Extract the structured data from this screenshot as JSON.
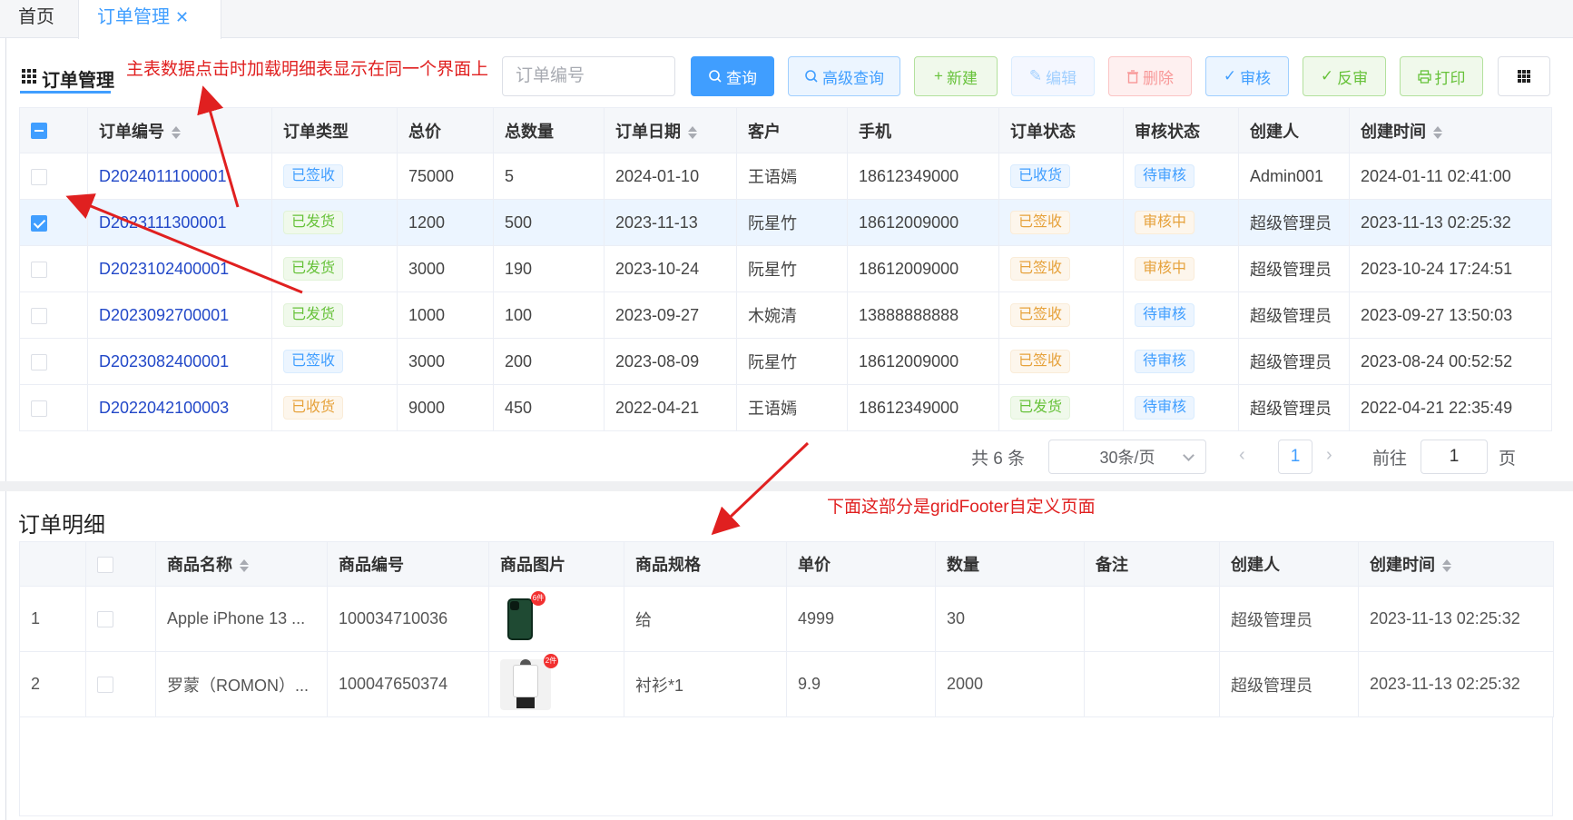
{
  "tabs": {
    "home": "首页",
    "active": "订单管理",
    "close": "✕"
  },
  "page_title": "订单管理",
  "annotations": {
    "top": "主表数据点击时加载明细表显示在同一个界面上",
    "bottom": "下面这部分是gridFooter自定义页面"
  },
  "search": {
    "placeholder": "订单编号"
  },
  "toolbar": {
    "query": "查询",
    "advanced": "高级查询",
    "new": "新建",
    "edit": "编辑",
    "delete": "删除",
    "audit": "审核",
    "unaudit": "反审",
    "print": "打印"
  },
  "main_table": {
    "headers": [
      "订单编号",
      "订单类型",
      "总价",
      "总数量",
      "订单日期",
      "客户",
      "手机",
      "订单状态",
      "审核状态",
      "创建人",
      "创建时间"
    ],
    "rows": [
      {
        "checked": false,
        "order_no": "D2024011100001",
        "type": "已签收",
        "type_color": "blue",
        "total": "75000",
        "qty": "5",
        "date": "2024-01-10",
        "customer": "王语嫣",
        "phone": "18612349000",
        "status": "已收货",
        "status_color": "blue",
        "audit": "待审核",
        "audit_color": "blue",
        "creator": "Admin001",
        "created": "2024-01-11 02:41:00"
      },
      {
        "checked": true,
        "order_no": "D2023111300001",
        "type": "已发货",
        "type_color": "green",
        "total": "1200",
        "qty": "500",
        "date": "2023-11-13",
        "customer": "阮星竹",
        "phone": "18612009000",
        "status": "已签收",
        "status_color": "orange",
        "audit": "审核中",
        "audit_color": "orange",
        "creator": "超级管理员",
        "created": "2023-11-13 02:25:32"
      },
      {
        "checked": false,
        "order_no": "D2023102400001",
        "type": "已发货",
        "type_color": "green",
        "total": "3000",
        "qty": "190",
        "date": "2023-10-24",
        "customer": "阮星竹",
        "phone": "18612009000",
        "status": "已签收",
        "status_color": "orange",
        "audit": "审核中",
        "audit_color": "orange",
        "creator": "超级管理员",
        "created": "2023-10-24 17:24:51"
      },
      {
        "checked": false,
        "order_no": "D2023092700001",
        "type": "已发货",
        "type_color": "green",
        "total": "1000",
        "qty": "100",
        "date": "2023-09-27",
        "customer": "木婉清",
        "phone": "13888888888",
        "status": "已签收",
        "status_color": "orange",
        "audit": "待审核",
        "audit_color": "blue",
        "creator": "超级管理员",
        "created": "2023-09-27 13:50:03"
      },
      {
        "checked": false,
        "order_no": "D2023082400001",
        "type": "已签收",
        "type_color": "blue",
        "total": "3000",
        "qty": "200",
        "date": "2023-08-09",
        "customer": "阮星竹",
        "phone": "18612009000",
        "status": "已签收",
        "status_color": "orange",
        "audit": "待审核",
        "audit_color": "blue",
        "creator": "超级管理员",
        "created": "2023-08-24 00:52:52"
      },
      {
        "checked": false,
        "order_no": "D2022042100003",
        "type": "已收货",
        "type_color": "orange",
        "total": "9000",
        "qty": "450",
        "date": "2022-04-21",
        "customer": "王语嫣",
        "phone": "18612349000",
        "status": "已发货",
        "status_color": "green",
        "audit": "待审核",
        "audit_color": "blue",
        "creator": "超级管理员",
        "created": "2022-04-21 22:35:49"
      }
    ]
  },
  "pagination": {
    "total": "共 6 条",
    "page_size": "30条/页",
    "prev": "‹",
    "current": "1",
    "next": "›",
    "goto": "前往",
    "jump_value": "1",
    "unit": "页"
  },
  "detail": {
    "title": "订单明细",
    "headers": [
      "商品名称",
      "商品编号",
      "商品图片",
      "商品规格",
      "单价",
      "数量",
      "备注",
      "创建人",
      "创建时间"
    ],
    "rows": [
      {
        "index": "1",
        "name": "Apple iPhone 13 ...",
        "code": "100034710036",
        "image": "phone",
        "image_badge": "6件",
        "spec": "给",
        "price": "4999",
        "qty": "30",
        "remark": "",
        "creator": "超级管理员",
        "created": "2023-11-13 02:25:32"
      },
      {
        "index": "2",
        "name": "罗蒙（ROMON）...",
        "code": "100047650374",
        "image": "shirt",
        "image_badge": "2件",
        "spec": "衬衫*1",
        "price": "9.9",
        "qty": "2000",
        "remark": "",
        "creator": "超级管理员",
        "created": "2023-11-13 02:25:32"
      }
    ]
  },
  "colors": {
    "primary": "#409eff",
    "annotation": "#e02020",
    "link": "#2248c8"
  }
}
